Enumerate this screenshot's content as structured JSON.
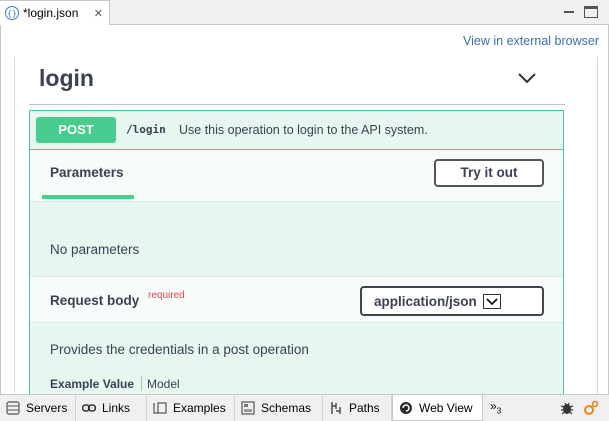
{
  "editor": {
    "tab_title": "*login.json",
    "tab_icon": "json-file-icon",
    "close_glyph": "✕"
  },
  "web_view": {
    "external_link": "View in external browser",
    "operation_group": "login",
    "operation": {
      "method": "POST",
      "path": "/login",
      "description": "Use this operation to login to the API system."
    },
    "parameters": {
      "tab_label": "Parameters",
      "try_button": "Try it out",
      "empty_text": "No parameters"
    },
    "request_body": {
      "label": "Request body",
      "required": "required",
      "content_type": "application/json",
      "description": "Provides the credentials in a post operation",
      "example_tab": "Example Value",
      "model_tab": "Model"
    },
    "colors": {
      "post_accent": "#49cc90",
      "post_background": "#e8f6f0",
      "link": "#3b6fb5",
      "required": "#e5484d"
    }
  },
  "bottom_tabs": [
    {
      "label": "Servers",
      "icon": "servers-icon"
    },
    {
      "label": "Links",
      "icon": "link-icon"
    },
    {
      "label": "Examples",
      "icon": "examples-icon"
    },
    {
      "label": "Schemas",
      "icon": "schemas-icon"
    },
    {
      "label": "Paths",
      "icon": "paths-icon"
    },
    {
      "label": "Web View",
      "icon": "web-view-icon",
      "active": true
    }
  ],
  "overflow": {
    "glyph": "»",
    "count": "3"
  }
}
